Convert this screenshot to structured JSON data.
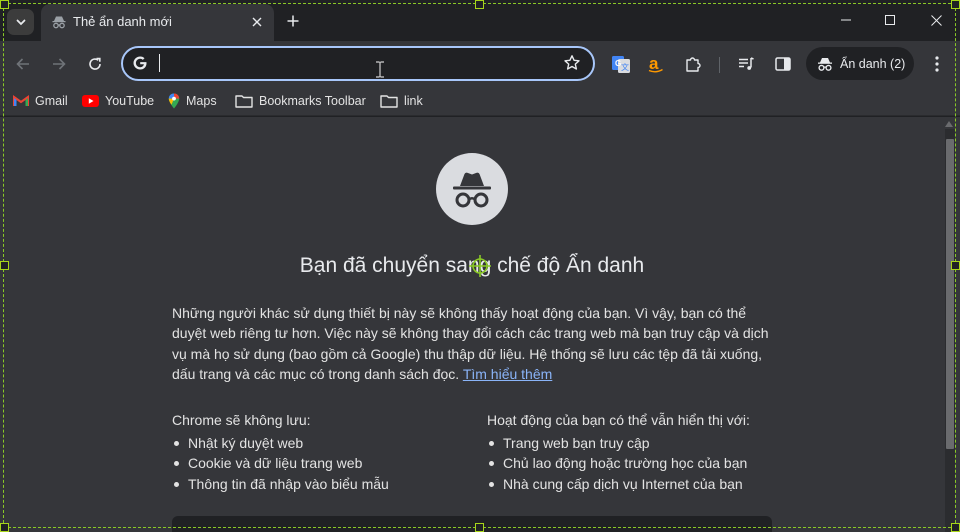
{
  "tab": {
    "title": "Thẻ ẩn danh mới"
  },
  "omnibox": {
    "value": ""
  },
  "toolbar": {
    "incognito_label": "Ẩn danh (2)"
  },
  "bookmarks": {
    "items": [
      {
        "label": "Gmail",
        "icon": "gmail-icon"
      },
      {
        "label": "YouTube",
        "icon": "youtube-icon"
      },
      {
        "label": "Maps",
        "icon": "maps-icon"
      },
      {
        "label": "Bookmarks Toolbar",
        "icon": "folder-icon"
      },
      {
        "label": "link",
        "icon": "folder-icon"
      }
    ]
  },
  "page": {
    "heading": "Bạn đã chuyển sang chế độ Ẩn danh",
    "intro": "Những người khác sử dụng thiết bị này sẽ không thấy hoạt động của bạn. Vì vậy, bạn có thể duyệt web riêng tư hơn. Việc này sẽ không thay đổi cách các trang web mà bạn truy cập và dịch vụ mà họ sử dụng (bao gồm cả Google) thu thập dữ liệu. Hệ thống sẽ lưu các tệp đã tải xuống, dấu trang và các mục có trong danh sách đọc.",
    "learn_more": "Tìm hiểu thêm",
    "left_col": {
      "title": "Chrome sẽ không lưu:",
      "items": [
        "Nhật ký duyệt web",
        "Cookie và dữ liệu trang web",
        "Thông tin đã nhập vào biểu mẫu"
      ]
    },
    "right_col": {
      "title": "Hoạt động của bạn có thể vẫn hiển thị với:",
      "items": [
        "Trang web bạn truy cập",
        "Chủ lao động hoặc trường học của bạn",
        "Nhà cung cấp dịch vụ Internet của bạn"
      ]
    }
  },
  "colors": {
    "accent": "#a8c7fa",
    "link": "#8ab4f8",
    "selection": "#8ac926"
  }
}
